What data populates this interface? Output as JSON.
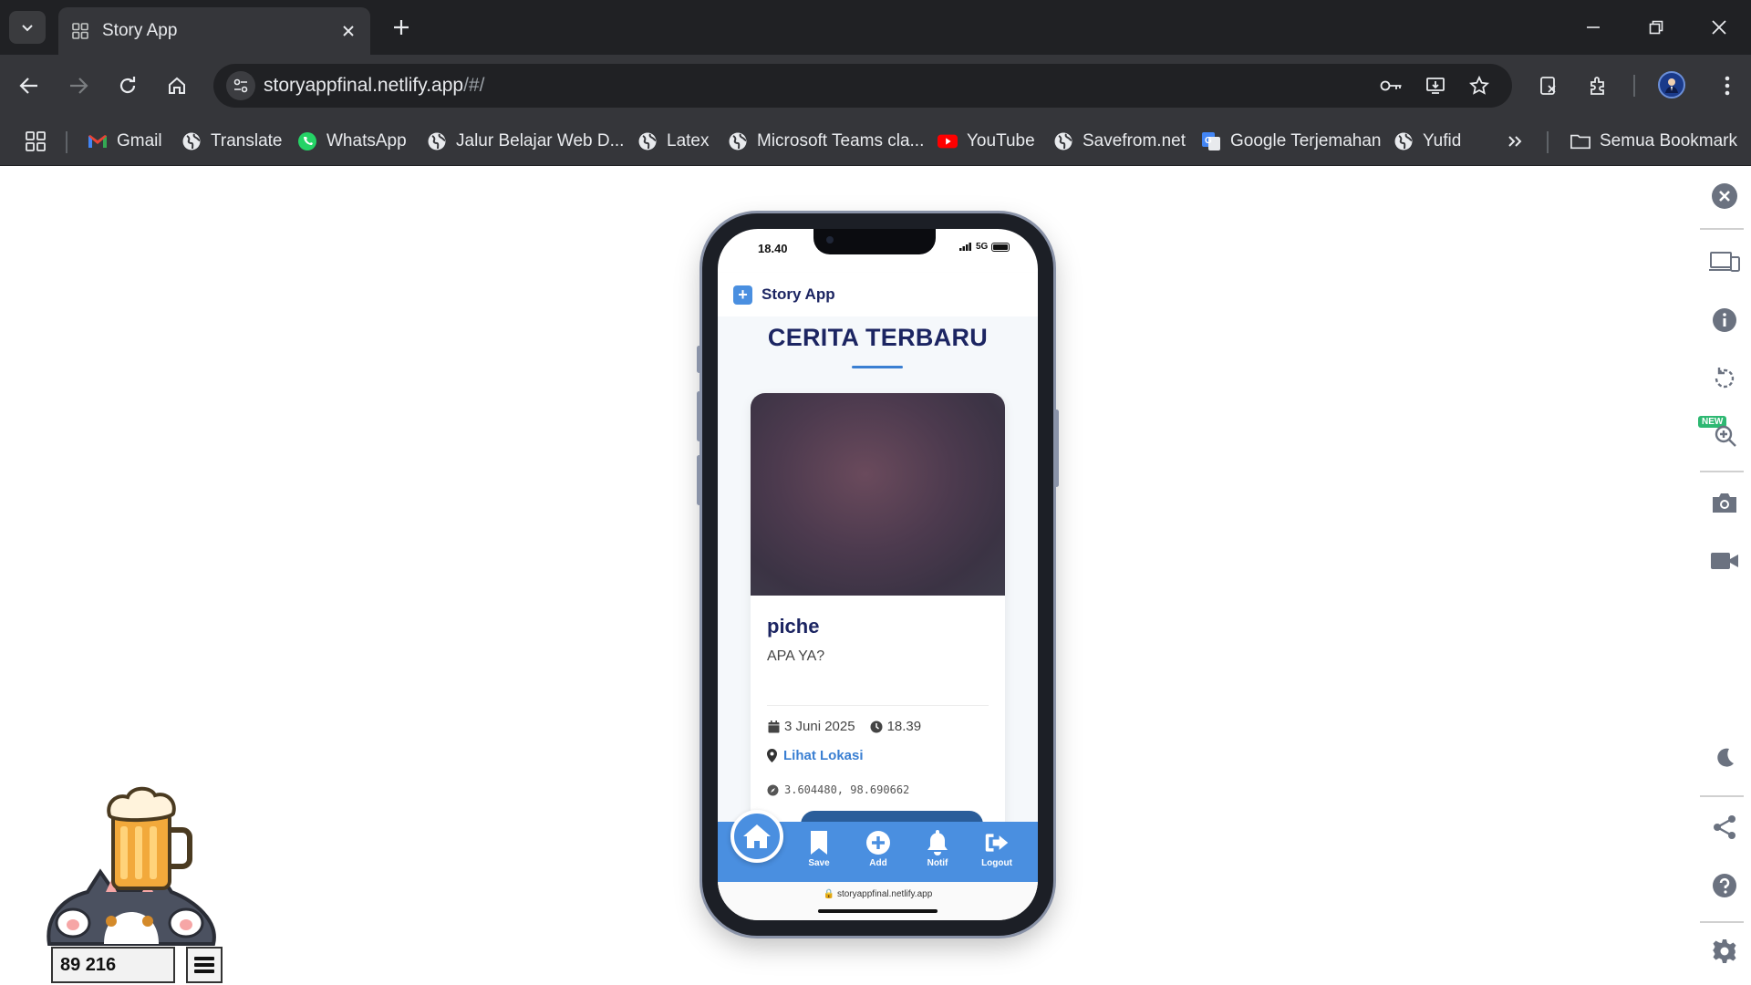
{
  "browser": {
    "tab": {
      "title": "Story App",
      "favicon": "grid-icon"
    },
    "url": {
      "host": "storyappfinal.netlify.app",
      "path": "/#/"
    },
    "bookmarks": [
      {
        "label": "Gmail",
        "icon": "gmail-icon"
      },
      {
        "label": "Translate",
        "icon": "globe-icon"
      },
      {
        "label": "WhatsApp",
        "icon": "whatsapp-icon"
      },
      {
        "label": "Jalur Belajar Web D...",
        "icon": "globe-icon"
      },
      {
        "label": "Latex",
        "icon": "globe-icon"
      },
      {
        "label": "Microsoft Teams cla...",
        "icon": "globe-icon"
      },
      {
        "label": "YouTube",
        "icon": "youtube-icon"
      },
      {
        "label": "Savefrom.net",
        "icon": "globe-icon"
      },
      {
        "label": "Google Terjemahan",
        "icon": "google-translate-icon"
      },
      {
        "label": "Yufid",
        "icon": "globe-icon"
      }
    ],
    "all_bookmarks_label": "Semua Bookmark"
  },
  "sidebar": {
    "new_badge": "NEW"
  },
  "phone": {
    "status": {
      "time": "18.40",
      "network": "5G"
    },
    "app": {
      "title": "Story App",
      "logo_symbol": "+"
    },
    "page_title": "CERITA TERBARU",
    "story": {
      "name": "piche",
      "description": "APA YA?",
      "date": "3 Juni 2025",
      "time": "18.39",
      "location_label": "Lihat Lokasi",
      "coordinates": "3.604480, 98.690662"
    },
    "bottom_nav": [
      {
        "label": "Save",
        "icon": "bookmark-icon"
      },
      {
        "label": "Add",
        "icon": "plus-circle-icon"
      },
      {
        "label": "Notif",
        "icon": "bell-icon"
      },
      {
        "label": "Logout",
        "icon": "logout-icon"
      }
    ],
    "url_bar": "storyappfinal.netlify.app"
  },
  "widget": {
    "counter": "89 216"
  },
  "colors": {
    "primary_blue": "#4a8fe0",
    "navy_text": "#1c2562",
    "link_blue": "#3a7fd2",
    "chrome_dark": "#202124",
    "chrome_mid": "#35363a"
  }
}
